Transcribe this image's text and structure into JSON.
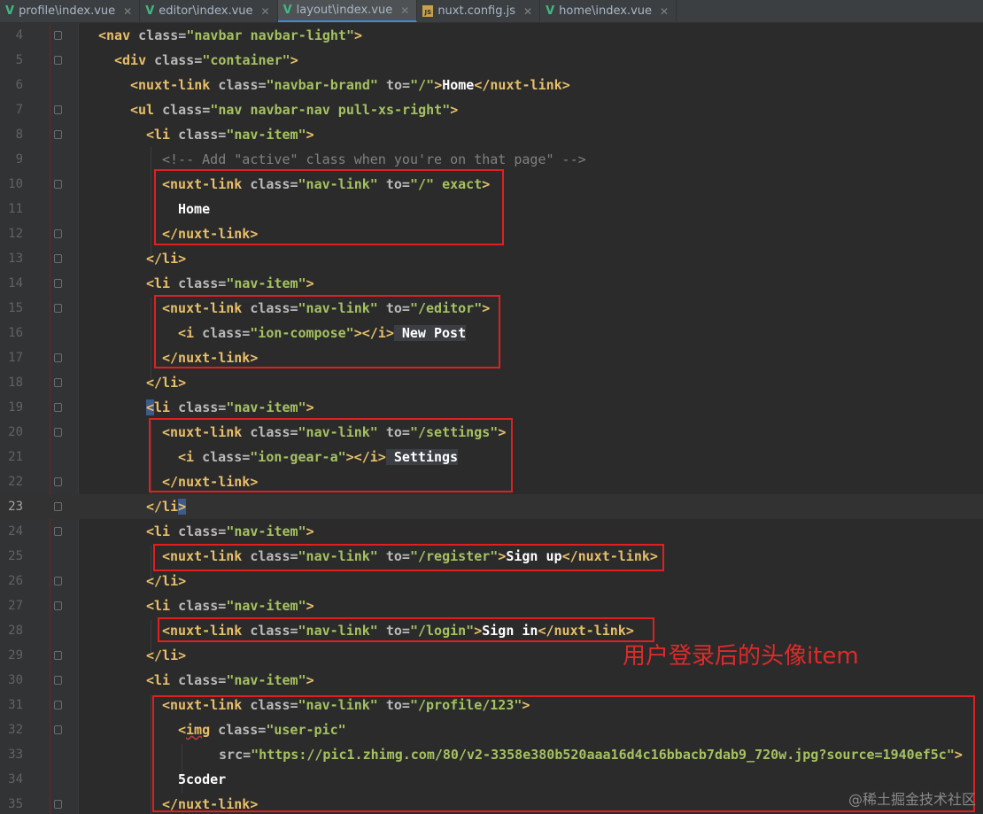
{
  "tabs": [
    {
      "label": "profile\\index.vue",
      "icon": "vue-file-icon",
      "active": false
    },
    {
      "label": "editor\\index.vue",
      "icon": "vue-file-icon",
      "active": false
    },
    {
      "label": "layout\\index.vue",
      "icon": "vue-file-icon",
      "active": true
    },
    {
      "label": "nuxt.config.js",
      "icon": "js-file-icon",
      "active": false
    },
    {
      "label": "home\\index.vue",
      "icon": "vue-file-icon",
      "active": false
    }
  ],
  "lines": [
    {
      "n": "4"
    },
    {
      "n": "5"
    },
    {
      "n": "6"
    },
    {
      "n": "7"
    },
    {
      "n": "8"
    },
    {
      "n": "9"
    },
    {
      "n": "10"
    },
    {
      "n": "11"
    },
    {
      "n": "12"
    },
    {
      "n": "13"
    },
    {
      "n": "14"
    },
    {
      "n": "15"
    },
    {
      "n": "16"
    },
    {
      "n": "17"
    },
    {
      "n": "18"
    },
    {
      "n": "19"
    },
    {
      "n": "20"
    },
    {
      "n": "21"
    },
    {
      "n": "22"
    },
    {
      "n": "23"
    },
    {
      "n": "24"
    },
    {
      "n": "25"
    },
    {
      "n": "26"
    },
    {
      "n": "27"
    },
    {
      "n": "28"
    },
    {
      "n": "29"
    },
    {
      "n": "30"
    },
    {
      "n": "31"
    },
    {
      "n": "32"
    },
    {
      "n": "33"
    },
    {
      "n": "34"
    },
    {
      "n": "35"
    }
  ],
  "code": {
    "l4": [
      "<nav",
      " class=",
      "\"navbar navbar-light\"",
      ">"
    ],
    "l5": [
      "<div",
      " class=",
      "\"container\"",
      ">"
    ],
    "l6": [
      "<nuxt-link",
      " class=",
      "\"navbar-brand\"",
      " to=",
      "\"/\"",
      ">",
      "Home",
      "</nuxt-link",
      ">"
    ],
    "l7": [
      "<ul",
      " class=",
      "\"nav navbar-nav pull-xs-right\"",
      ">"
    ],
    "l8": [
      "<li",
      " class=",
      "\"nav-item\"",
      ">"
    ],
    "l9": "<!-- Add \"active\" class when you're on that page\" -->",
    "l10": [
      "<nuxt-link",
      " class=",
      "\"nav-link\"",
      " to=",
      "\"/\"",
      " exact",
      ">"
    ],
    "l11": "Home",
    "l12": [
      "</nuxt-link",
      ">"
    ],
    "l13": [
      "</li",
      ">"
    ],
    "l14": [
      "<li",
      " class=",
      "\"nav-item\"",
      ">"
    ],
    "l15": [
      "<nuxt-link",
      " class=",
      "\"nav-link\"",
      " to=",
      "\"/editor\"",
      ">"
    ],
    "l16": [
      "<i",
      " class=",
      "\"ion-compose\"",
      "></i",
      ">",
      " New Post"
    ],
    "l17": [
      "</nuxt-link",
      ">"
    ],
    "l18": [
      "</li",
      ">"
    ],
    "l19": [
      "<",
      "li",
      " class=",
      "\"nav-item\"",
      ">"
    ],
    "l20": [
      "<nuxt-link",
      " class=",
      "\"nav-link\"",
      " to=",
      "\"/settings\"",
      ">"
    ],
    "l21": [
      "<i",
      " class=",
      "\"ion-gear-a\"",
      "></i",
      ">",
      " Settings"
    ],
    "l22": [
      "</nuxt-link",
      ">"
    ],
    "l23": [
      "</li",
      ">"
    ],
    "l24": [
      "<li",
      " class=",
      "\"nav-item\"",
      ">"
    ],
    "l25": [
      "<nuxt-link",
      " class=",
      "\"nav-link\"",
      " to=",
      "\"/register\"",
      ">",
      "Sign up",
      "</nuxt-link",
      ">"
    ],
    "l26": [
      "</li",
      ">"
    ],
    "l27": [
      "<li",
      " class=",
      "\"nav-item\"",
      ">"
    ],
    "l28": [
      "<nuxt-link",
      " class=",
      "\"nav-link\"",
      " to=",
      "\"/login\"",
      ">",
      "Sign in",
      "</nuxt-link",
      ">"
    ],
    "l29": [
      "</li",
      ">"
    ],
    "l30": [
      "<li",
      " class=",
      "\"nav-item\"",
      ">"
    ],
    "l31": [
      "<nuxt-link",
      " class=",
      "\"nav-link\"",
      " to=",
      "\"/profile/123\"",
      ">"
    ],
    "l32": [
      "<",
      "img",
      " class=",
      "\"user-pic\""
    ],
    "l33": [
      " src=",
      "\"https://pic1.zhimg.com/80/v2-3358e380b520aaa16d4c16bbacb7dab9_720w.jpg?source=1940ef5c\"",
      ">"
    ],
    "l34": "5coder",
    "l35": [
      "</nuxt-link",
      ">"
    ]
  },
  "annotation": "用户登录后的头像item",
  "watermark": "@稀土掘金技术社区",
  "colors": {
    "background": "#2b2b2b",
    "tag": "#e8bf6a",
    "attr_value": "#a5c261",
    "comment": "#808080",
    "annotation_red": "#e02020",
    "vue_icon": "#41b883"
  }
}
